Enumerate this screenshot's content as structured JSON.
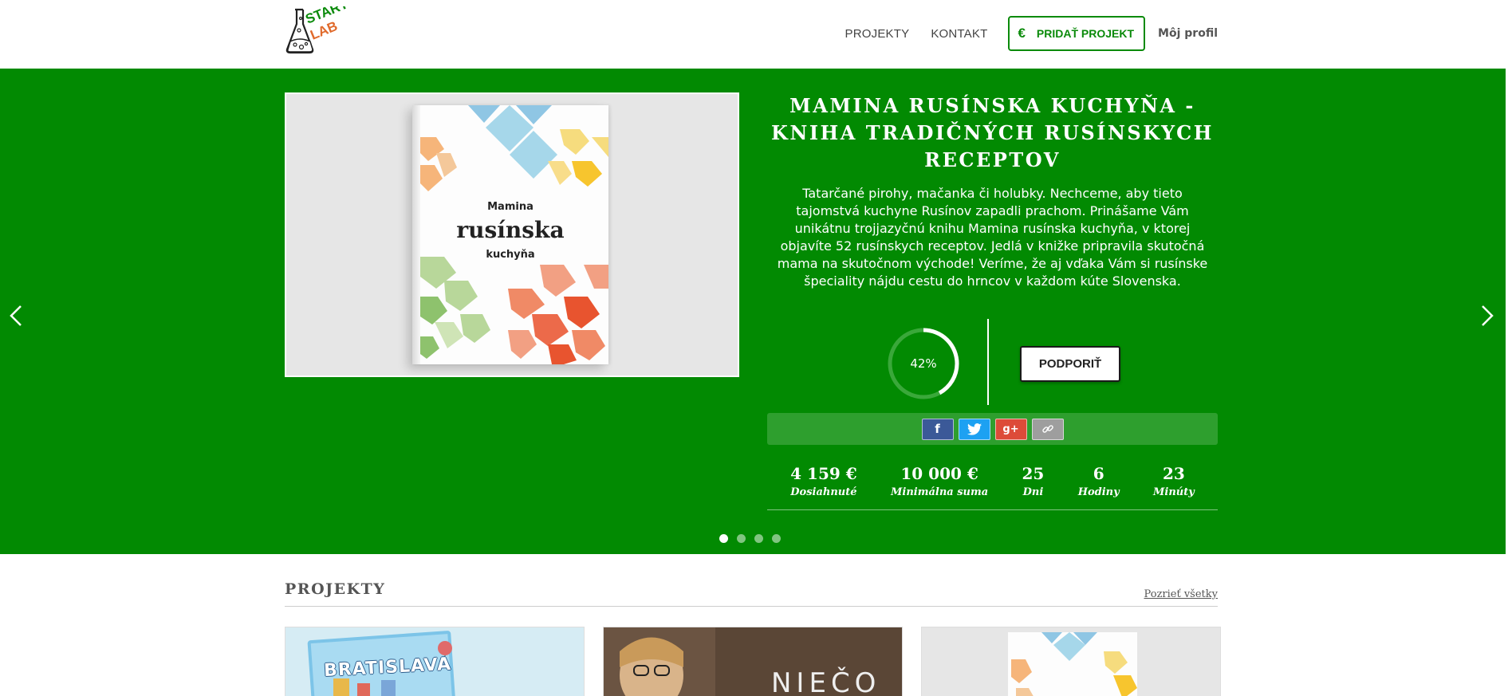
{
  "header": {
    "logo_text_top": "START",
    "logo_text_bottom": "LAB",
    "nav": {
      "projects": "PROJEKTY",
      "contact": "KONTAKT",
      "add_project_icon": "€",
      "add_project": "PRIDAŤ PROJEKT",
      "profile": "Môj profil"
    }
  },
  "hero": {
    "title": "MAMINA RUSÍNSKA KUCHYŇA - KNIHA TRADIČNÝCH RUSÍNSKYCH RECEPTOV",
    "description": "Tatarčané pirohy, mačanka či holubky. Nechceme, aby tieto tajomstvá kuchyne Rusínov zapadli prachom. Prinášame Vám unikátnu trojjazyčnú knihu Mamina rusínska kuchyňa, v ktorej objavíte 52 rusínskych receptov. Jedlá v knižke pripravila skutočná mama na skutočnom východe! Veríme, že aj vďaka Vám si rusínske špeciality nájdu cestu do hrncov v každom kúte Slovenska.",
    "book": {
      "line1": "Mamina",
      "line2": "rusínska",
      "line3": "kuchyňa"
    },
    "progress_percent": 42,
    "progress_label": "42%",
    "support_button": "PODPORIŤ",
    "share": {
      "facebook": "f",
      "twitter": "twitter-icon",
      "googleplus": "g+",
      "link": "link-icon"
    },
    "stats": [
      {
        "value": "4 159 €",
        "label": "Dosiahnuté"
      },
      {
        "value": "10 000 €",
        "label": "Minimálna suma"
      },
      {
        "value": "25",
        "label": "Dni"
      },
      {
        "value": "6",
        "label": "Hodiny"
      },
      {
        "value": "23",
        "label": "Minúty"
      }
    ],
    "slides_count": 4,
    "active_slide": 1
  },
  "projects": {
    "title": "PROJEKTY",
    "see_all": "Pozrieť všetky",
    "cards": [
      {
        "text": "BRATISLAVA"
      },
      {
        "text": "NIEČO"
      },
      {
        "text": ""
      }
    ]
  },
  "colors": {
    "brand_green": "#028a02",
    "accent_orange": "#e06a2c"
  }
}
